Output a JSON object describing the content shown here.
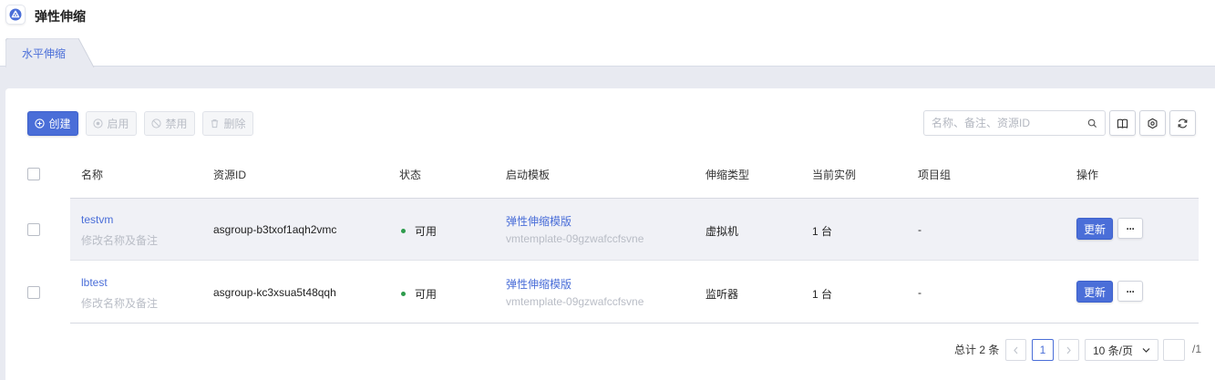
{
  "app": {
    "title": "弹性伸缩",
    "logo_icon": "autoscale-logo-icon",
    "accent_color": "#4a6ed8"
  },
  "tabs": [
    {
      "label": "水平伸缩",
      "active": true
    }
  ],
  "toolbar": {
    "create_label": "创建",
    "enable_label": "启用",
    "disable_label": "禁用",
    "delete_label": "删除",
    "search_placeholder": "名称、备注、资源ID",
    "search_value": "",
    "icons": [
      "book-icon",
      "settings-icon",
      "refresh-icon"
    ]
  },
  "table": {
    "columns": [
      "名称",
      "资源ID",
      "状态",
      "启动模板",
      "伸缩类型",
      "当前实例",
      "项目组",
      "操作"
    ],
    "rows": [
      {
        "name": "testvm",
        "name_note": "修改名称及备注",
        "resource_id": "asgroup-b3txof1aqh2vmc",
        "status": "可用",
        "status_color": "#2e9c4d",
        "template_name": "弹性伸缩模版",
        "template_id": "vmtemplate-09gzwafccfsvne",
        "scale_type": "虚拟机",
        "instances": "1 台",
        "project_group": "-",
        "update_label": "更新",
        "more_label": "···"
      },
      {
        "name": "lbtest",
        "name_note": "修改名称及备注",
        "resource_id": "asgroup-kc3xsua5t48qqh",
        "status": "可用",
        "status_color": "#2e9c4d",
        "template_name": "弹性伸缩模版",
        "template_id": "vmtemplate-09gzwafccfsvne",
        "scale_type": "监听器",
        "instances": "1 台",
        "project_group": "-",
        "update_label": "更新",
        "more_label": "···"
      }
    ]
  },
  "pagination": {
    "total_text": "总计 2 条",
    "current_page": "1",
    "page_size": "10 条/页",
    "jump_value": "",
    "total_pages": "/1"
  }
}
